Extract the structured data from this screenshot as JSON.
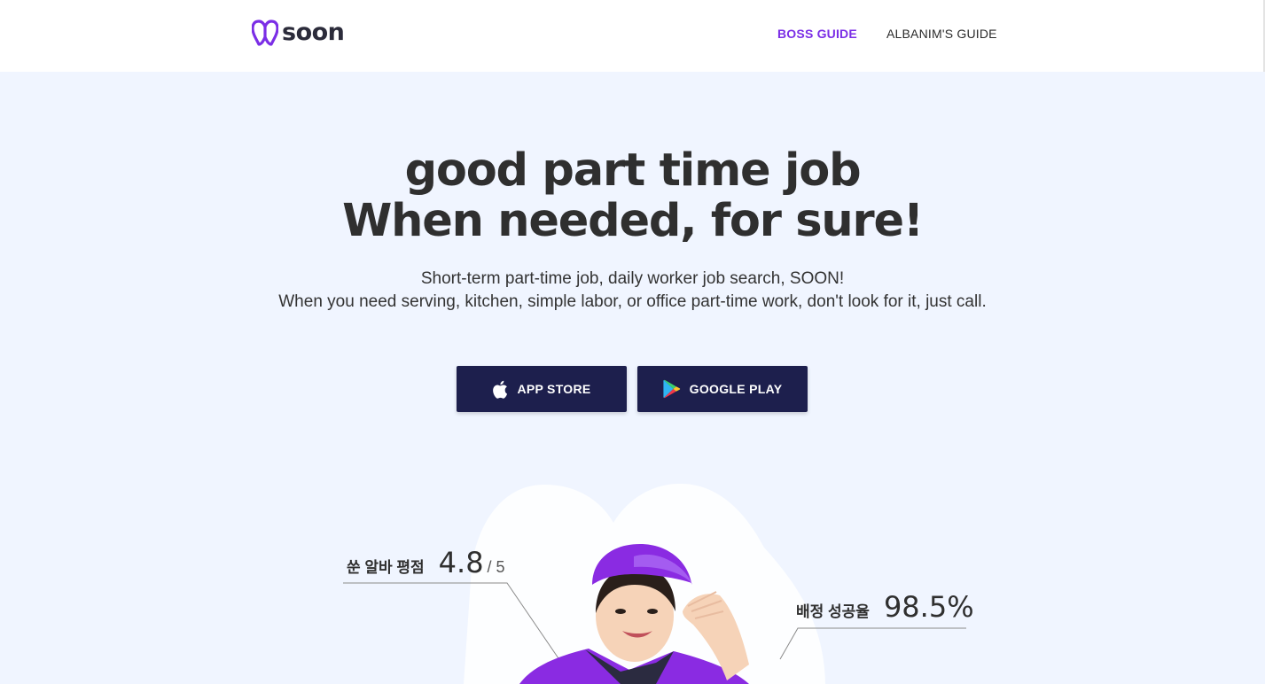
{
  "brand": {
    "name": "soon",
    "color": "#7b2ee6"
  },
  "nav": {
    "boss_guide": "BOSS GUIDE",
    "albanim_guide": "ALBANIM'S GUIDE"
  },
  "hero": {
    "title_line1": "good part time job",
    "title_line2": "When needed, for sure!",
    "subtitle_line1": "Short-term part-time job, daily worker job search, SOON!",
    "subtitle_line2": "When you need serving, kitchen, simple labor, or office part-time work, don't look for it, just call."
  },
  "buttons": {
    "app_store": {
      "label": "APP STORE",
      "icon": "apple-icon"
    },
    "google_play": {
      "label": "GOOGLE PLAY",
      "icon": "google-play-icon"
    }
  },
  "stats": {
    "rating": {
      "label": "쑨 알바 평점",
      "value": "4.8",
      "scale": "/ 5"
    },
    "assignment": {
      "label": "배정 성공율",
      "value": "98.5%"
    }
  },
  "colors": {
    "background": "#f0f5ff",
    "button": "#1d1f4d",
    "accent": "#7b2ee6"
  }
}
